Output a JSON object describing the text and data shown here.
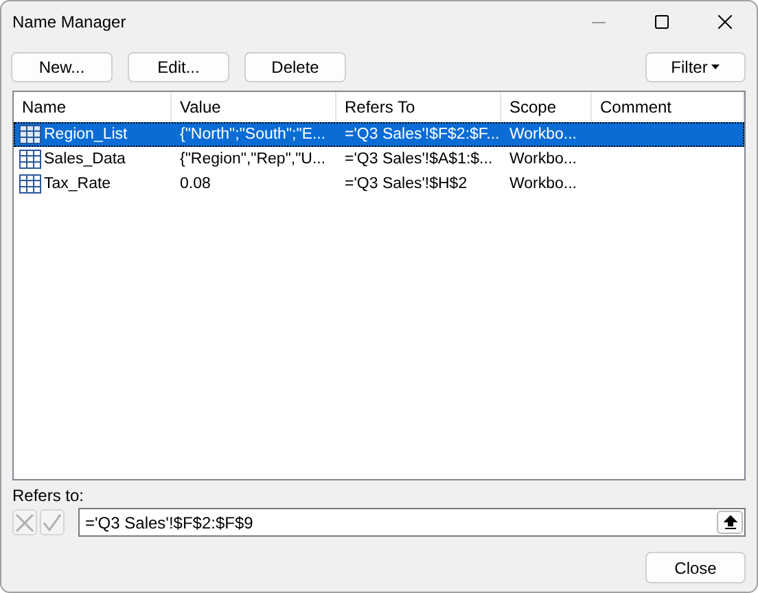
{
  "window": {
    "title": "Name Manager"
  },
  "toolbar": {
    "buttons": [
      "New...",
      "Edit...",
      "Delete"
    ],
    "filter": "Filter"
  },
  "table": {
    "columns": [
      "Name",
      "Value",
      "Refers To",
      "Scope",
      "Comment"
    ],
    "rows": [
      {
        "name": "Region_List",
        "value": "{\"North\";\"South\";\"E...",
        "refers_to": "='Q3 Sales'!$F$2:$F...",
        "scope": "Workbo...",
        "selected": true
      },
      {
        "name": "Sales_Data",
        "value": "{\"Region\",\"Rep\",\"U...",
        "refers_to": "='Q3 Sales'!$A$1:$...",
        "scope": "Workbo...",
        "selected": false
      },
      {
        "name": "Tax_Rate",
        "value": "0.08",
        "refers_to": "='Q3 Sales'!$H$2",
        "scope": "Workbo...",
        "selected": false
      }
    ]
  },
  "refers_to": {
    "label": "Refers to:",
    "value": "='Q3 Sales'!$F$2:$F$9"
  },
  "buttons": {
    "close": "Close"
  }
}
